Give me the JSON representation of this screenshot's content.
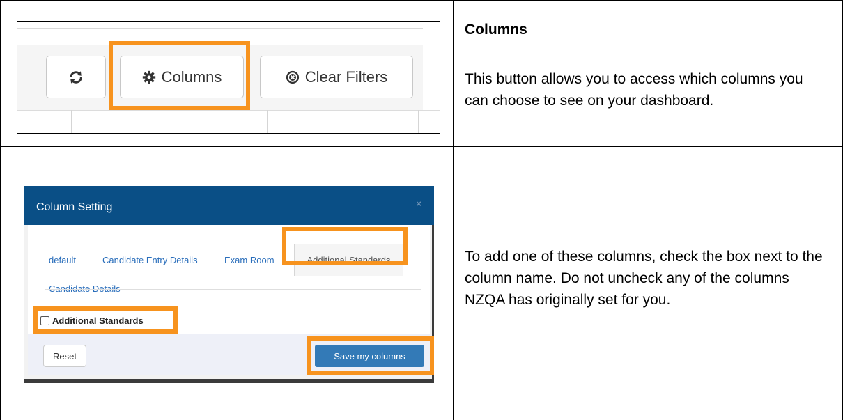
{
  "row1": {
    "toolbar": {
      "refresh_icon": "refresh-icon",
      "columns_label": "Columns",
      "columns_icon": "gear-icon",
      "clear_filters_label": "Clear Filters",
      "clear_filters_icon": "circle-x-icon"
    },
    "heading": "Columns",
    "description": "This button allows you to access which columns you can choose to see on your dashboard."
  },
  "row2": {
    "modal": {
      "title": "Column Setting",
      "close": "×",
      "tabs": [
        "default",
        "Candidate Entry Details",
        "Exam Room",
        "Additional Standards",
        "Candidate Details"
      ],
      "active_tab": "Additional Standards",
      "checkbox_label": "Additional Standards",
      "reset_label": "Reset",
      "save_label": "Save my columns"
    },
    "description": "To add one of these columns, check the box next to the column name. Do not uncheck any of the columns NZQA has originally set for you."
  },
  "colors": {
    "highlight": "#f7931e",
    "modal_header": "#0a4f86",
    "primary_button": "#337ab7",
    "link": "#2a6ebb"
  }
}
